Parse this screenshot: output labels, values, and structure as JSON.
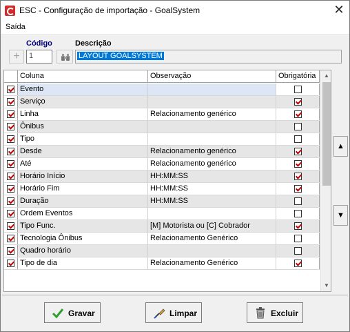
{
  "window": {
    "title": "ESC - Configuração de importação - GoalSystem"
  },
  "menu": {
    "items": [
      "Saída"
    ]
  },
  "form": {
    "codigo_label": "Código",
    "codigo_value": "1",
    "descricao_label": "Descrição",
    "descricao_value": "LAYOUT GOALSYSTEM"
  },
  "grid": {
    "columns": [
      "Coluna",
      "Observação",
      "Obrigatória"
    ],
    "rows": [
      {
        "included": true,
        "coluna": "Evento",
        "observacao": "",
        "obrigatoria": false
      },
      {
        "included": true,
        "coluna": "Serviço",
        "observacao": "",
        "obrigatoria": true
      },
      {
        "included": true,
        "coluna": "Linha",
        "observacao": "Relacionamento genérico",
        "obrigatoria": true
      },
      {
        "included": true,
        "coluna": "Ônibus",
        "observacao": "",
        "obrigatoria": false
      },
      {
        "included": true,
        "coluna": "Tipo",
        "observacao": "",
        "obrigatoria": false
      },
      {
        "included": true,
        "coluna": "Desde",
        "observacao": "Relacionamento genérico",
        "obrigatoria": true
      },
      {
        "included": true,
        "coluna": "Até",
        "observacao": "Relacionamento genérico",
        "obrigatoria": true
      },
      {
        "included": true,
        "coluna": "Horário Início",
        "observacao": "HH:MM:SS",
        "obrigatoria": true
      },
      {
        "included": true,
        "coluna": "Horário Fim",
        "observacao": "HH:MM:SS",
        "obrigatoria": true
      },
      {
        "included": true,
        "coluna": "Duração",
        "observacao": "HH:MM:SS",
        "obrigatoria": false
      },
      {
        "included": true,
        "coluna": "Ordem Eventos",
        "observacao": "",
        "obrigatoria": false
      },
      {
        "included": true,
        "coluna": "Tipo Func.",
        "observacao": "[M] Motorista ou [C] Cobrador",
        "obrigatoria": true
      },
      {
        "included": true,
        "coluna": "Tecnologia Ônibus",
        "observacao": "Relacionamento Genérico",
        "obrigatoria": false
      },
      {
        "included": true,
        "coluna": "Quadro horário",
        "observacao": "",
        "obrigatoria": false
      },
      {
        "included": true,
        "coluna": "Tipo de dia",
        "observacao": "Relacionamento Genérico",
        "obrigatoria": true
      }
    ]
  },
  "buttons": {
    "gravar": "Gravar",
    "limpar": "Limpar",
    "excluir": "Excluir"
  },
  "colors": {
    "accent_selection": "#0078d7",
    "codigo_label": "#000080",
    "check_mark": "#c00000"
  }
}
